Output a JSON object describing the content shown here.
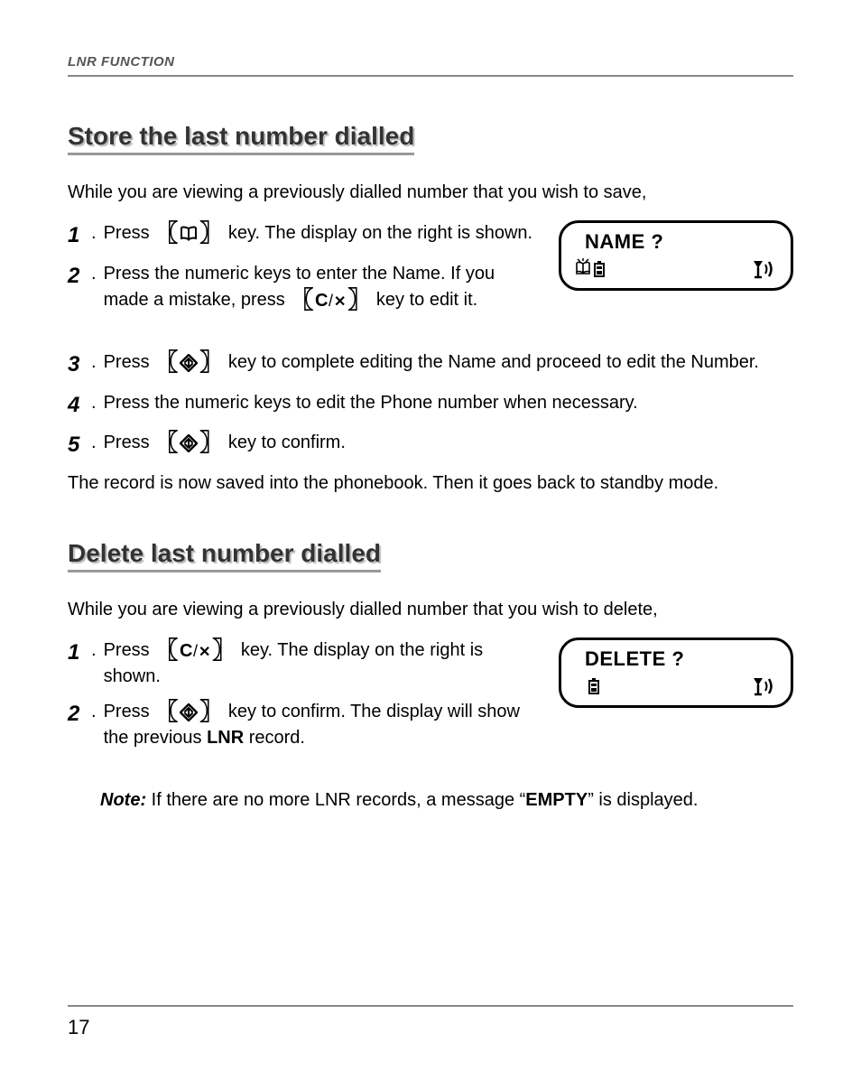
{
  "header": {
    "running": "LNR FUNCTION"
  },
  "pageNumber": "17",
  "section1": {
    "title": "Store the last number dialled",
    "intro": "While you are viewing a previously dialled number that you wish to save,",
    "steps": {
      "s1a": "Press ",
      "s1b": " key. The display on the right is shown.",
      "s2a": "Press the numeric keys to enter the Name. If you made a mistake, press ",
      "s2b": " key to edit it.",
      "s3a": "Press ",
      "s3b": " key to complete editing the Name and proceed to edit the Number.",
      "s4": "Press the numeric keys to edit the Phone number when necessary.",
      "s5a": "Press ",
      "s5b": " key to confirm."
    },
    "closing": "The record is now saved into the phonebook. Then it goes back to standby mode.",
    "lcd": {
      "label": "NAME ?"
    }
  },
  "section2": {
    "title": "Delete last number dialled",
    "intro": "While you are viewing a previously dialled number that you wish to delete,",
    "steps": {
      "s1a": "Press ",
      "s1b": " key. The display on the right is shown.",
      "s2a": "Press ",
      "s2b": " key to confirm. The display will show the previous ",
      "s2c": "LNR",
      "s2d": " record."
    },
    "lcd": {
      "label": "DELETE ?"
    },
    "note": {
      "label": "Note:",
      "a": " If there are no more LNR records, a message “",
      "b": "EMPTY",
      "c": "” is displayed."
    }
  }
}
